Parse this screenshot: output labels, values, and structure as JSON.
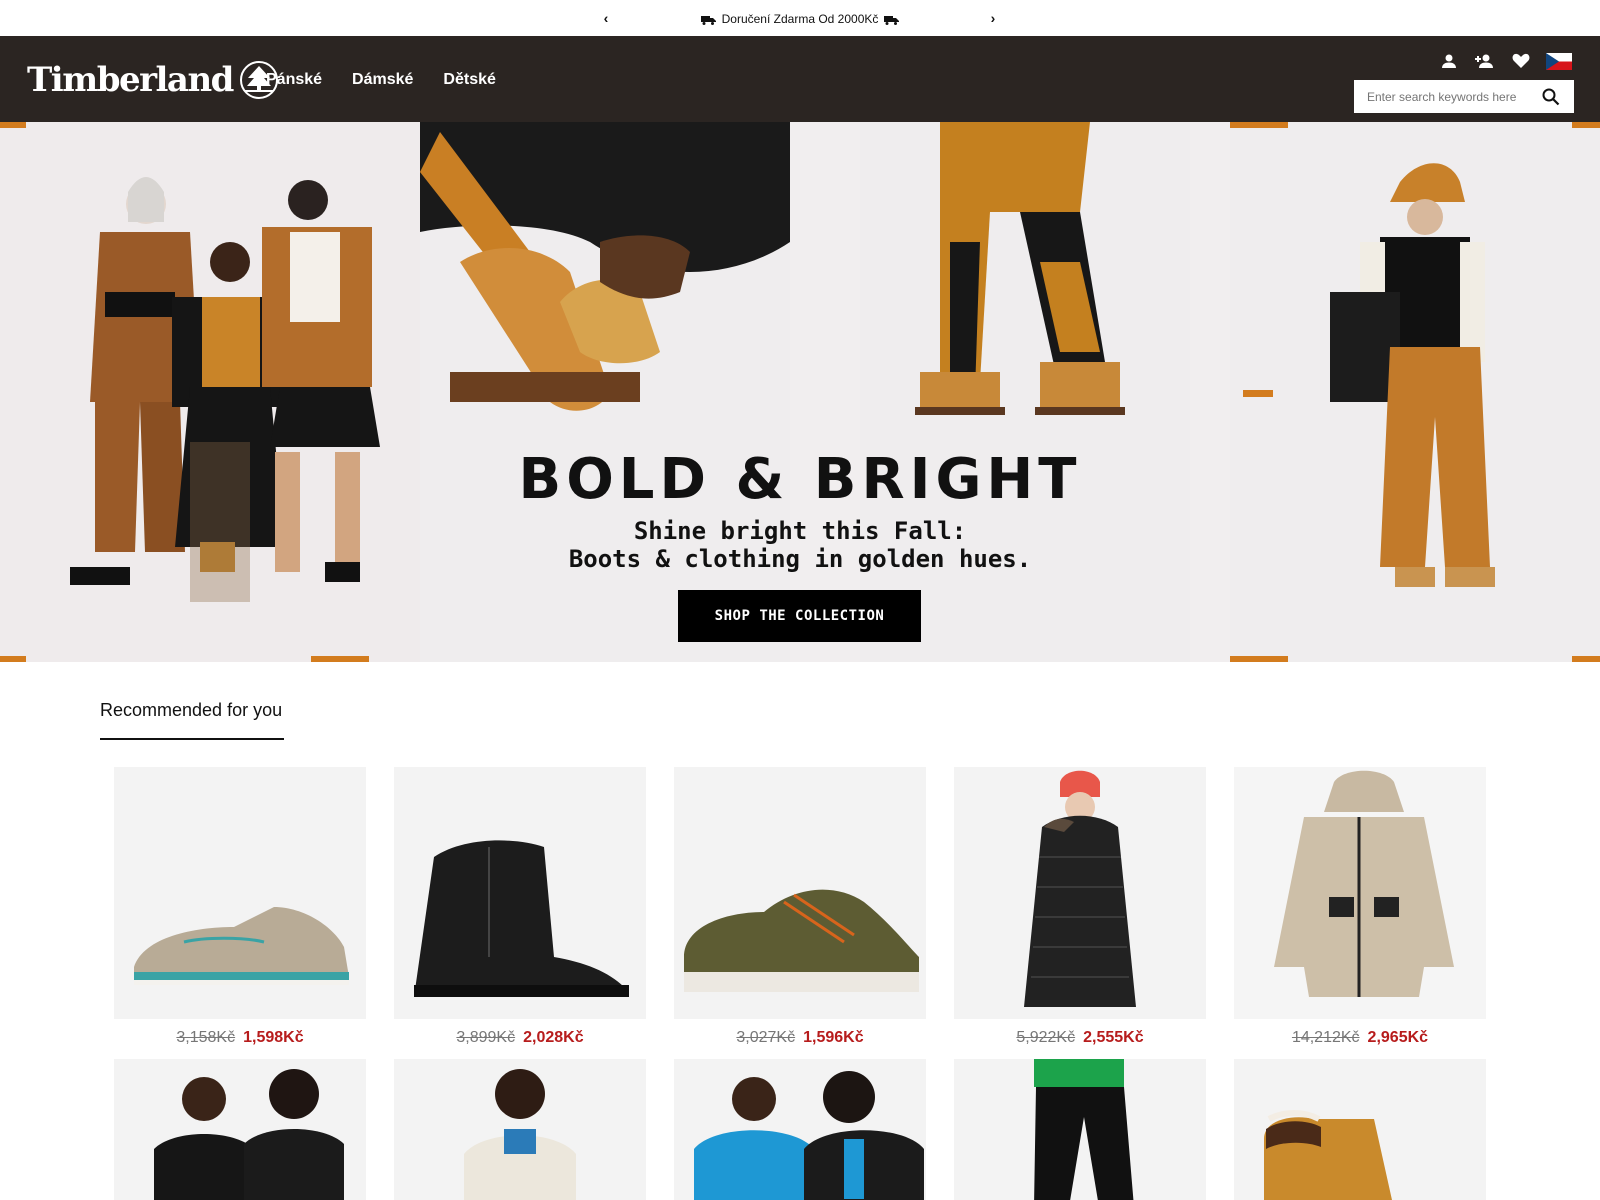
{
  "promo": {
    "prev": "‹",
    "next": "›",
    "message": "Doručení Zdarma Od 2000Kč"
  },
  "header": {
    "logo_text": "Timberland",
    "nav": [
      "Pánské",
      "Dámské",
      "Dětské"
    ],
    "icons": [
      "user-icon",
      "add-user-icon",
      "heart-icon",
      "czech-flag"
    ],
    "search_placeholder": "Enter search keywords here"
  },
  "hero": {
    "title": "BOLD & BRIGHT",
    "subtitle_line1": "Shine bright this Fall:",
    "subtitle_line2": "Boots & clothing in golden hues.",
    "cta": "SHOP THE COLLECTION"
  },
  "recommended": {
    "title": "Recommended for you",
    "products": [
      {
        "old_price": "3,158Kč",
        "new_price": "1,598Kč",
        "kind": "boat-shoe"
      },
      {
        "old_price": "3,899Kč",
        "new_price": "2,028Kč",
        "kind": "black-boot"
      },
      {
        "old_price": "3,027Kč",
        "new_price": "1,596Kč",
        "kind": "olive-sneaker"
      },
      {
        "old_price": "5,922Kč",
        "new_price": "2,555Kč",
        "kind": "puffer-coat"
      },
      {
        "old_price": "14,212Kč",
        "new_price": "2,965Kč",
        "kind": "parka"
      }
    ],
    "second_row": [
      "fleece-jackets",
      "fleece-pullover",
      "blue-jackets",
      "black-pants",
      "wheat-boot"
    ]
  },
  "colors": {
    "header_bg": "#2b2522",
    "accent_orange": "#d37c1e",
    "sale_red": "#b71c1c"
  }
}
